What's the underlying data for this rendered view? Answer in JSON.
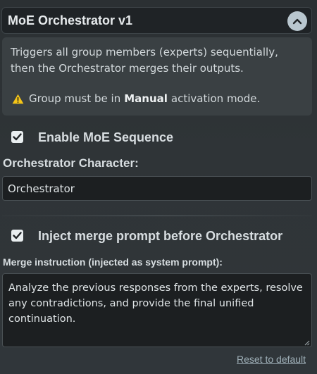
{
  "header": {
    "title": "MoE Orchestrator v1",
    "collapse_icon": "chevron-up-icon"
  },
  "info": {
    "line1": "Triggers all group members (experts) sequentially,",
    "line2": "then the Orchestrator merges their outputs.",
    "warning_prefix": "Group must be in",
    "warning_strong": "Manual",
    "warning_suffix": "activation mode.",
    "warning_icon": "warning-icon"
  },
  "enable_sequence": {
    "label": "Enable MoE Sequence",
    "checked": true
  },
  "orchestrator": {
    "label": "Orchestrator Character:",
    "value": "Orchestrator"
  },
  "inject_prompt": {
    "label": "Inject merge prompt before Orchestrator",
    "checked": true
  },
  "merge": {
    "label": "Merge instruction (injected as system prompt):",
    "value": "Analyze the previous responses from the experts, resolve any contradictions, and provide the final unified continuation."
  },
  "reset": {
    "label": "Reset to default"
  },
  "colors": {
    "checkbox_fill": "#e9eef0",
    "check_mark": "#1f2326",
    "warning": "#f5c518",
    "link": "#9fb0b8"
  }
}
